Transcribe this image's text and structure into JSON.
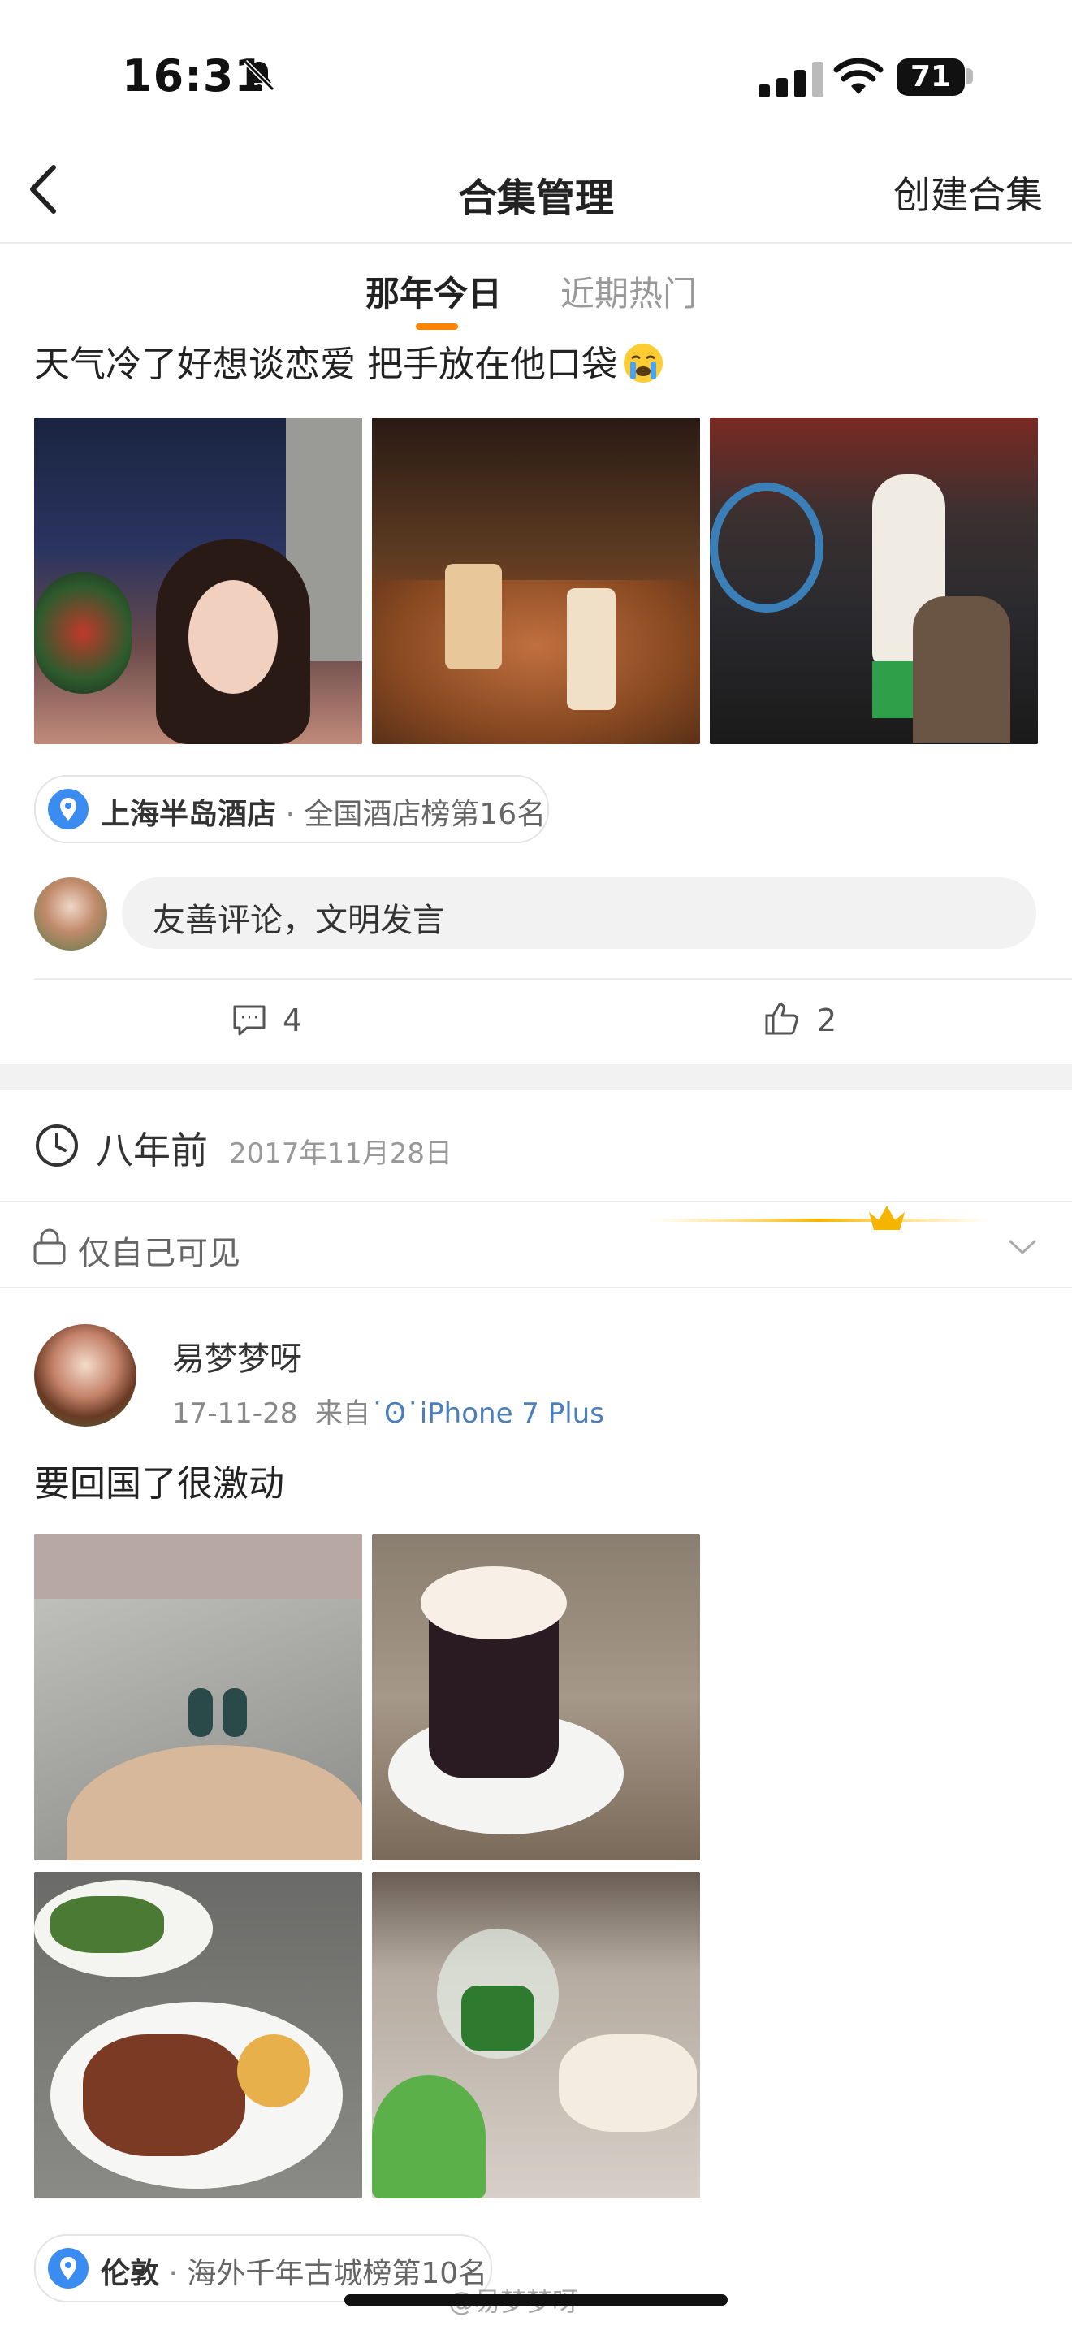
{
  "status_bar": {
    "time": "16:31",
    "battery": "71"
  },
  "nav": {
    "title": "合集管理",
    "action": "创建合集"
  },
  "tabs": [
    {
      "label": "那年今日"
    },
    {
      "label": "近期热门"
    }
  ],
  "post1": {
    "text": "天气冷了好想谈恋爱 把手放在他口袋",
    "emoji": "crying-face-icon",
    "location": "上海半岛酒店",
    "location_rank": "全国酒店榜第16名",
    "comment_placeholder": "友善评论，文明发言",
    "comments": "4",
    "likes": "2"
  },
  "memory": {
    "ago": "八年前",
    "date": "2017年11月28日",
    "visibility": "仅自己可见"
  },
  "post2": {
    "username": "易梦梦呀",
    "time": "17-11-28",
    "source_prefix": "来自",
    "source": "˙ʘ˙iPhone 7 Plus",
    "text": "要回国了很激动",
    "location": "伦敦",
    "location_rank": "海外千年古城榜第10名"
  },
  "watermark": "@易梦梦呀",
  "colors": {
    "accent": "#ff8200",
    "link": "#4a7ebd",
    "pin": "#3b8cf0"
  }
}
